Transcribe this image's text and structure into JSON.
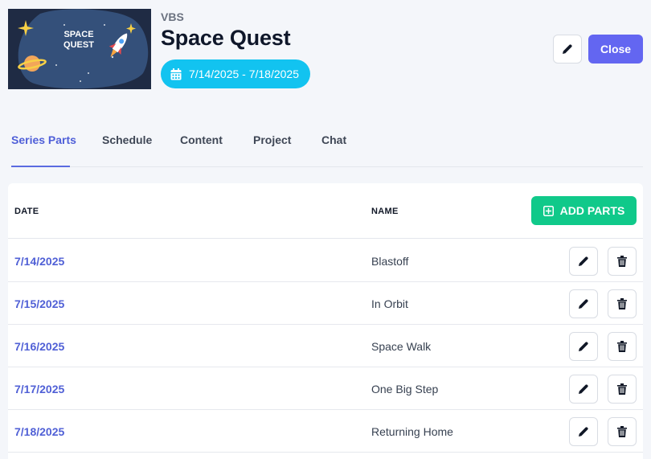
{
  "header": {
    "thumbnail": {
      "text_line1": "SPACE",
      "text_line2": "QUEST"
    },
    "category": "VBS",
    "title": "Space Quest",
    "date_range": "7/14/2025 - 7/18/2025",
    "close_label": "Close"
  },
  "tabs": [
    {
      "label": "Series Parts",
      "active": true
    },
    {
      "label": "Schedule",
      "active": false
    },
    {
      "label": "Content",
      "active": false
    },
    {
      "label": "Project",
      "active": false
    },
    {
      "label": "Chat",
      "active": false
    }
  ],
  "table": {
    "columns": [
      "DATE",
      "NAME"
    ],
    "add_label": "ADD PARTS",
    "rows": [
      {
        "date": "7/14/2025",
        "name": "Blastoff"
      },
      {
        "date": "7/15/2025",
        "name": "In Orbit"
      },
      {
        "date": "7/16/2025",
        "name": "Space Walk"
      },
      {
        "date": "7/17/2025",
        "name": "One Big Step"
      },
      {
        "date": "7/18/2025",
        "name": "Returning Home"
      }
    ]
  },
  "icons": {
    "edit": "pencil-icon",
    "delete": "trash-icon",
    "calendar": "calendar-icon",
    "add": "plus-square-icon"
  },
  "colors": {
    "accent": "#6366f1",
    "date_pill": "#12c3f0",
    "add_button": "#10c98a",
    "link_date": "#5060d6"
  }
}
